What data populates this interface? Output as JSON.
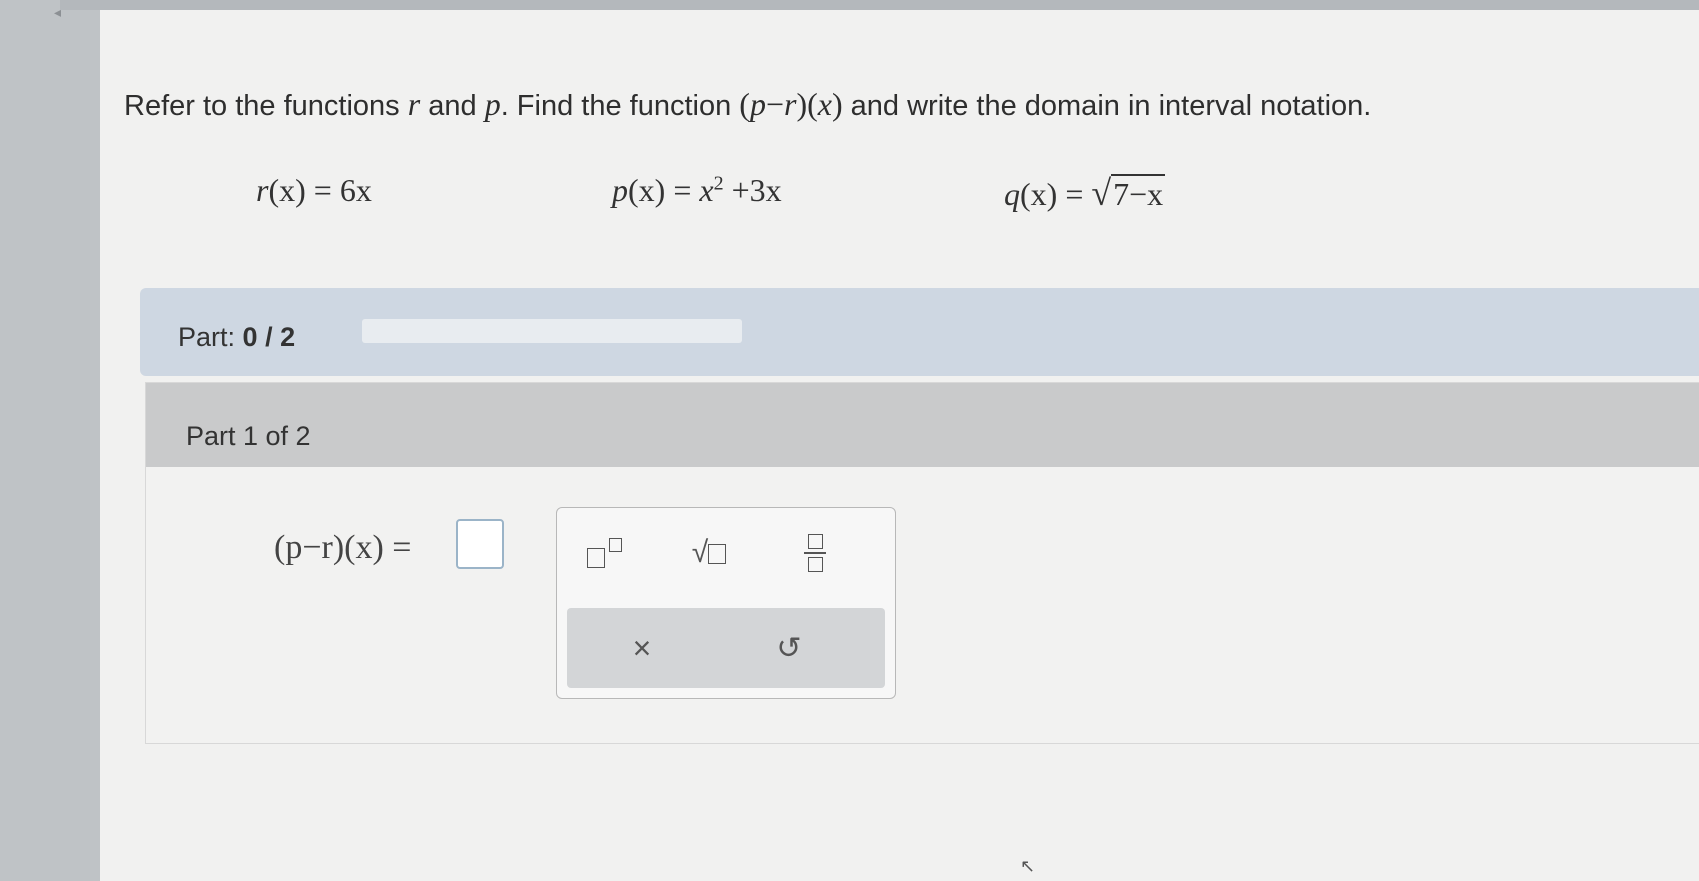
{
  "question": {
    "intro": "Refer to the functions",
    "var_r": "r",
    "and": "and",
    "var_p": "p",
    "find": ". Find the function",
    "func_expr_open": "(",
    "func_p": "p",
    "func_minus": "−",
    "func_r": "r",
    "func_close": ")(",
    "func_x": "x",
    "func_end": ")",
    "rest": "and write the domain in interval notation."
  },
  "functions": {
    "r": {
      "name": "r",
      "arg": "(x)",
      "eq": "=",
      "rhs": "6x"
    },
    "p": {
      "name": "p",
      "arg": "(x)",
      "eq": "=",
      "rhs_base": "x",
      "rhs_exp": "2",
      "rhs_tail": "+3x"
    },
    "q": {
      "name": "q",
      "arg": "(x)",
      "eq": "=",
      "radicand": "7−x"
    }
  },
  "part_progress": {
    "label": "Part:",
    "value": "0 / 2",
    "fraction": 0
  },
  "part_header": "Part 1 of 2",
  "answer": {
    "expr_lhs": "(p−r)(x)",
    "eq": "="
  },
  "keypad": {
    "keys": [
      "superscript-key",
      "sqrt-key",
      "fraction-key"
    ],
    "clear_symbol": "×",
    "undo_symbol": "↺"
  },
  "colors": {
    "progress_fill": "#3d73b5",
    "partbar": "#ced7e2",
    "panel_head": "#c9cacb"
  }
}
